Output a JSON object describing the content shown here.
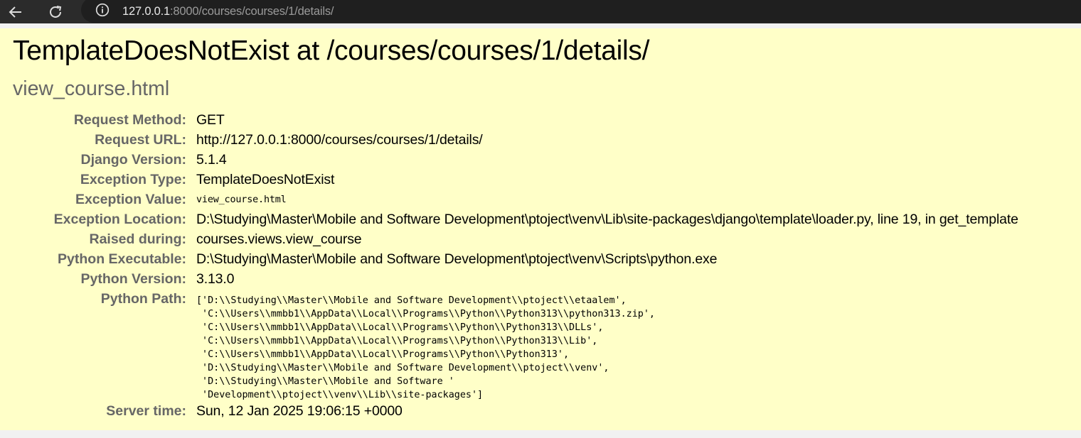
{
  "browser": {
    "url_host": "127.0.0.1",
    "url_rest": ":8000/courses/courses/1/details/"
  },
  "error": {
    "title": "TemplateDoesNotExist at /courses/courses/1/details/",
    "exception_value_heading": "view_course.html"
  },
  "meta": {
    "request_method_label": "Request Method:",
    "request_method": "GET",
    "request_url_label": "Request URL:",
    "request_url": "http://127.0.0.1:8000/courses/courses/1/details/",
    "django_version_label": "Django Version:",
    "django_version": "5.1.4",
    "exception_type_label": "Exception Type:",
    "exception_type": "TemplateDoesNotExist",
    "exception_value_label": "Exception Value:",
    "exception_value": "view_course.html",
    "exception_location_label": "Exception Location:",
    "exception_location": "D:\\Studying\\Master\\Mobile and Software Development\\ptoject\\venv\\Lib\\site-packages\\django\\template\\loader.py, line 19, in get_template",
    "raised_during_label": "Raised during:",
    "raised_during": "courses.views.view_course",
    "python_executable_label": "Python Executable:",
    "python_executable": "D:\\Studying\\Master\\Mobile and Software Development\\ptoject\\venv\\Scripts\\python.exe",
    "python_version_label": "Python Version:",
    "python_version": "3.13.0",
    "python_path_label": "Python Path:",
    "python_path": "['D:\\\\Studying\\\\Master\\\\Mobile and Software Development\\\\ptoject\\\\etaalem',\n 'C:\\\\Users\\\\mmbb1\\\\AppData\\\\Local\\\\Programs\\\\Python\\\\Python313\\\\python313.zip',\n 'C:\\\\Users\\\\mmbb1\\\\AppData\\\\Local\\\\Programs\\\\Python\\\\Python313\\\\DLLs',\n 'C:\\\\Users\\\\mmbb1\\\\AppData\\\\Local\\\\Programs\\\\Python\\\\Python313\\\\Lib',\n 'C:\\\\Users\\\\mmbb1\\\\AppData\\\\Local\\\\Programs\\\\Python\\\\Python313',\n 'D:\\\\Studying\\\\Master\\\\Mobile and Software Development\\\\ptoject\\\\venv',\n 'D:\\\\Studying\\\\Master\\\\Mobile and Software '\n 'Development\\\\ptoject\\\\venv\\\\Lib\\\\site-packages']",
    "server_time_label": "Server time:",
    "server_time": "Sun, 12 Jan 2025 19:06:15 +0000"
  },
  "colors": {
    "page_bg": "#ffffc8",
    "label": "#666666",
    "browser_bar": "#2b2b2b"
  },
  "icons": {
    "back": "arrow-left-icon",
    "reload": "reload-icon",
    "info": "info-circle-icon"
  }
}
